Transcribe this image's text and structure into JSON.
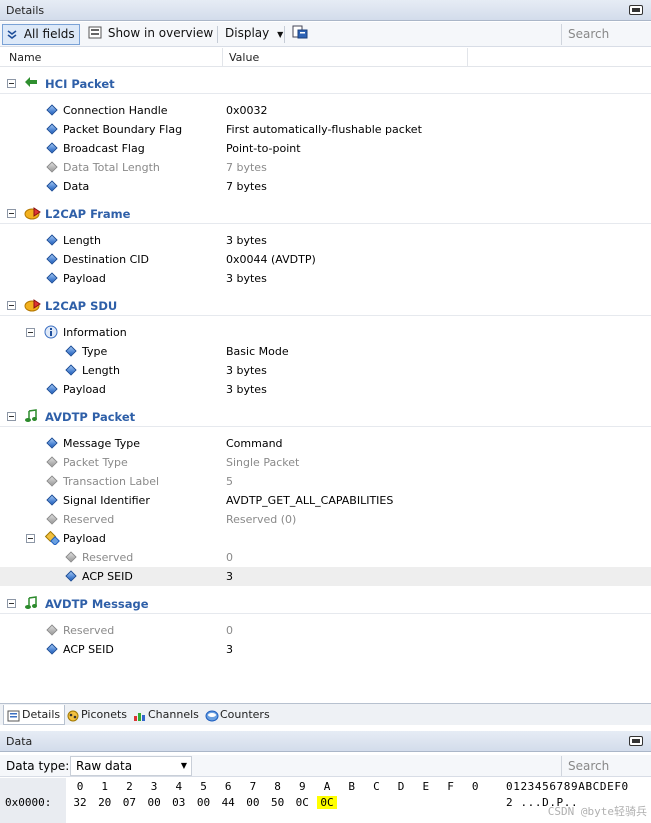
{
  "details_panel": {
    "title": "Details"
  },
  "toolbar": {
    "all_fields": "All fields",
    "show_in_overview": "Show in overview",
    "display": "Display",
    "search_placeholder": "Search"
  },
  "columns": {
    "name": "Name",
    "value": "Value"
  },
  "tree": [
    {
      "kind": "section",
      "label": "HCI Packet",
      "icon": "hci-arrow-icon"
    },
    {
      "kind": "field",
      "label": "Connection Handle",
      "value": "0x0032"
    },
    {
      "kind": "field",
      "label": "Packet Boundary Flag",
      "value": "First automatically-flushable packet"
    },
    {
      "kind": "field",
      "label": "Broadcast Flag",
      "value": "Point-to-point"
    },
    {
      "kind": "field",
      "label": "Data Total Length",
      "value": "7 bytes",
      "dim": true
    },
    {
      "kind": "field",
      "label": "Data",
      "value": "7 bytes"
    },
    {
      "kind": "section",
      "label": "L2CAP Frame",
      "icon": "l2cap-icon"
    },
    {
      "kind": "field",
      "label": "Length",
      "value": "3 bytes"
    },
    {
      "kind": "field",
      "label": "Destination CID",
      "value": "0x0044 (AVDTP)"
    },
    {
      "kind": "field",
      "label": "Payload",
      "value": "3 bytes"
    },
    {
      "kind": "section",
      "label": "L2CAP SDU",
      "icon": "l2cap-icon"
    },
    {
      "kind": "group",
      "label": "Information",
      "icon": "info-icon"
    },
    {
      "kind": "subfield",
      "label": "Type",
      "value": "Basic Mode"
    },
    {
      "kind": "subfield",
      "label": "Length",
      "value": "3 bytes"
    },
    {
      "kind": "field",
      "label": "Payload",
      "value": "3 bytes"
    },
    {
      "kind": "section",
      "label": "AVDTP Packet",
      "icon": "music-note-icon"
    },
    {
      "kind": "field",
      "label": "Message Type",
      "value": "Command"
    },
    {
      "kind": "field",
      "label": "Packet Type",
      "value": "Single Packet",
      "dim": true
    },
    {
      "kind": "field",
      "label": "Transaction Label",
      "value": "5",
      "dim": true
    },
    {
      "kind": "field",
      "label": "Signal Identifier",
      "value": "AVDTP_GET_ALL_CAPABILITIES"
    },
    {
      "kind": "field",
      "label": "Reserved",
      "value": "Reserved (0)",
      "dim": true
    },
    {
      "kind": "group",
      "label": "Payload",
      "icon": "payload-icon"
    },
    {
      "kind": "subfield",
      "label": "Reserved",
      "value": "0",
      "dim": true
    },
    {
      "kind": "subfield",
      "label": "ACP SEID",
      "value": "3",
      "selected": true
    },
    {
      "kind": "section",
      "label": "AVDTP Message",
      "icon": "music-note-icon"
    },
    {
      "kind": "field",
      "label": "Reserved",
      "value": "0",
      "dim": true
    },
    {
      "kind": "field",
      "label": "ACP SEID",
      "value": "3"
    }
  ],
  "bottom_tabs": [
    {
      "label": "Details",
      "icon": "details-icon",
      "active": true
    },
    {
      "label": "Piconets",
      "icon": "piconets-icon"
    },
    {
      "label": "Channels",
      "icon": "channels-icon"
    },
    {
      "label": "Counters",
      "icon": "counters-icon"
    }
  ],
  "data_panel": {
    "title": "Data",
    "data_type_label": "Data type:",
    "data_type_value": "Raw data",
    "search_placeholder": "Search",
    "hex_header": [
      "0",
      "1",
      "2",
      "3",
      "4",
      "5",
      "6",
      "7",
      "8",
      "9",
      "A",
      "B",
      "C",
      "D",
      "E",
      "F",
      "0"
    ],
    "ascii_header": "0123456789ABCDEF0",
    "row_offset": "0x0000:",
    "row_bytes": [
      "32",
      "20",
      "07",
      "00",
      "03",
      "00",
      "44",
      "00",
      "50",
      "0C",
      "0C"
    ],
    "highlighted_byte_index": 10,
    "ascii_row": "2 ...D.P..",
    "watermark": "CSDN @byte轻骑兵"
  }
}
